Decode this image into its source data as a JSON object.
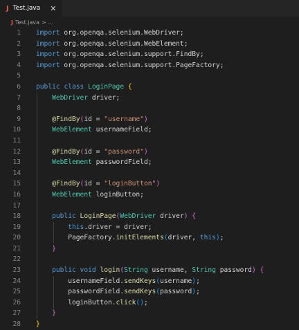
{
  "tab": {
    "file_icon": "J",
    "filename": "Test.java",
    "close_icon": "✕"
  },
  "breadcrumb": {
    "file_icon": "J",
    "filename": "Test.java",
    "separator": ">",
    "more": "..."
  },
  "editor": {
    "lines": [
      {
        "num": "1",
        "tokens": [
          [
            "kw",
            "import"
          ],
          [
            "pl",
            " org.openqa.selenium.WebDriver;"
          ]
        ]
      },
      {
        "num": "2",
        "tokens": [
          [
            "kw",
            "import"
          ],
          [
            "pl",
            " org.openqa.selenium.WebElement;"
          ]
        ]
      },
      {
        "num": "3",
        "tokens": [
          [
            "kw",
            "import"
          ],
          [
            "pl",
            " org.openqa.selenium.support.FindBy;"
          ]
        ]
      },
      {
        "num": "4",
        "tokens": [
          [
            "kw",
            "import"
          ],
          [
            "pl",
            " org.openqa.selenium.support.PageFactory;"
          ]
        ]
      },
      {
        "num": "5",
        "tokens": []
      },
      {
        "num": "6",
        "tokens": [
          [
            "kw",
            "public"
          ],
          [
            "pl",
            " "
          ],
          [
            "kw",
            "class"
          ],
          [
            "pl",
            " "
          ],
          [
            "ty",
            "LoginPage"
          ],
          [
            "pl",
            " "
          ],
          [
            "b1",
            "{"
          ]
        ]
      },
      {
        "num": "7",
        "tokens": [
          [
            "pl",
            "    "
          ],
          [
            "ty",
            "WebDriver"
          ],
          [
            "pl",
            " driver;"
          ]
        ]
      },
      {
        "num": "8",
        "tokens": []
      },
      {
        "num": "9",
        "tokens": [
          [
            "pl",
            "    "
          ],
          [
            "ann",
            "@FindBy"
          ],
          [
            "b2",
            "("
          ],
          [
            "pl",
            "id = "
          ],
          [
            "str",
            "\"username\""
          ],
          [
            "b2",
            ")"
          ]
        ]
      },
      {
        "num": "10",
        "tokens": [
          [
            "pl",
            "    "
          ],
          [
            "ty",
            "WebElement"
          ],
          [
            "pl",
            " usernameField;"
          ]
        ]
      },
      {
        "num": "11",
        "tokens": []
      },
      {
        "num": "12",
        "tokens": [
          [
            "pl",
            "    "
          ],
          [
            "ann",
            "@FindBy"
          ],
          [
            "b2",
            "("
          ],
          [
            "pl",
            "id = "
          ],
          [
            "str",
            "\"password\""
          ],
          [
            "b2",
            ")"
          ]
        ]
      },
      {
        "num": "13",
        "tokens": [
          [
            "pl",
            "    "
          ],
          [
            "ty",
            "WebElement"
          ],
          [
            "pl",
            " passwordField;"
          ]
        ]
      },
      {
        "num": "14",
        "tokens": []
      },
      {
        "num": "15",
        "tokens": [
          [
            "pl",
            "    "
          ],
          [
            "ann",
            "@FindBy"
          ],
          [
            "b2",
            "("
          ],
          [
            "pl",
            "id = "
          ],
          [
            "str",
            "\"loginButton\""
          ],
          [
            "b2",
            ")"
          ]
        ]
      },
      {
        "num": "16",
        "tokens": [
          [
            "pl",
            "    "
          ],
          [
            "ty",
            "WebElement"
          ],
          [
            "pl",
            " loginButton;"
          ]
        ]
      },
      {
        "num": "17",
        "tokens": []
      },
      {
        "num": "18",
        "tokens": [
          [
            "pl",
            "    "
          ],
          [
            "kw",
            "public"
          ],
          [
            "pl",
            " "
          ],
          [
            "fn",
            "LoginPage"
          ],
          [
            "b2",
            "("
          ],
          [
            "ty",
            "WebDriver"
          ],
          [
            "pl",
            " driver"
          ],
          [
            "b2",
            ")"
          ],
          [
            "pl",
            " "
          ],
          [
            "b2",
            "{"
          ]
        ]
      },
      {
        "num": "19",
        "tokens": [
          [
            "pl",
            "        "
          ],
          [
            "kw",
            "this"
          ],
          [
            "pl",
            ".driver = driver;"
          ]
        ]
      },
      {
        "num": "20",
        "tokens": [
          [
            "pl",
            "        PageFactory."
          ],
          [
            "fn",
            "initElements"
          ],
          [
            "b3",
            "("
          ],
          [
            "pl",
            "driver, "
          ],
          [
            "kw",
            "this"
          ],
          [
            "b3",
            ")"
          ],
          [
            "pl",
            ";"
          ]
        ]
      },
      {
        "num": "21",
        "tokens": [
          [
            "pl",
            "    "
          ],
          [
            "b2",
            "}"
          ]
        ]
      },
      {
        "num": "22",
        "tokens": []
      },
      {
        "num": "23",
        "tokens": [
          [
            "pl",
            "    "
          ],
          [
            "kw",
            "public"
          ],
          [
            "pl",
            " "
          ],
          [
            "kw",
            "void"
          ],
          [
            "pl",
            " "
          ],
          [
            "fn",
            "login"
          ],
          [
            "b2",
            "("
          ],
          [
            "ty",
            "String"
          ],
          [
            "pl",
            " username, "
          ],
          [
            "ty",
            "String"
          ],
          [
            "pl",
            " password"
          ],
          [
            "b2",
            ")"
          ],
          [
            "pl",
            " "
          ],
          [
            "b2",
            "{"
          ]
        ]
      },
      {
        "num": "24",
        "tokens": [
          [
            "pl",
            "        usernameField."
          ],
          [
            "fn",
            "sendKeys"
          ],
          [
            "b3",
            "("
          ],
          [
            "pl",
            "username"
          ],
          [
            "b3",
            ")"
          ],
          [
            "pl",
            ";"
          ]
        ]
      },
      {
        "num": "25",
        "tokens": [
          [
            "pl",
            "        passwordField."
          ],
          [
            "fn",
            "sendKeys"
          ],
          [
            "b3",
            "("
          ],
          [
            "pl",
            "password"
          ],
          [
            "b3",
            ")"
          ],
          [
            "pl",
            ";"
          ]
        ]
      },
      {
        "num": "26",
        "tokens": [
          [
            "pl",
            "        loginButton."
          ],
          [
            "fn",
            "click"
          ],
          [
            "b3",
            "()"
          ],
          [
            "pl",
            ";"
          ]
        ]
      },
      {
        "num": "27",
        "tokens": [
          [
            "pl",
            "    "
          ],
          [
            "b2",
            "}"
          ]
        ]
      },
      {
        "num": "28",
        "tokens": [
          [
            "b1",
            "}"
          ]
        ]
      }
    ]
  },
  "colors": {
    "background": "#1e1e1e",
    "tabbar": "#252526",
    "keyword": "#569cd6",
    "type": "#4ec9b0",
    "function": "#dcdcaa",
    "string": "#ce9178",
    "java_icon": "#e8573f"
  }
}
